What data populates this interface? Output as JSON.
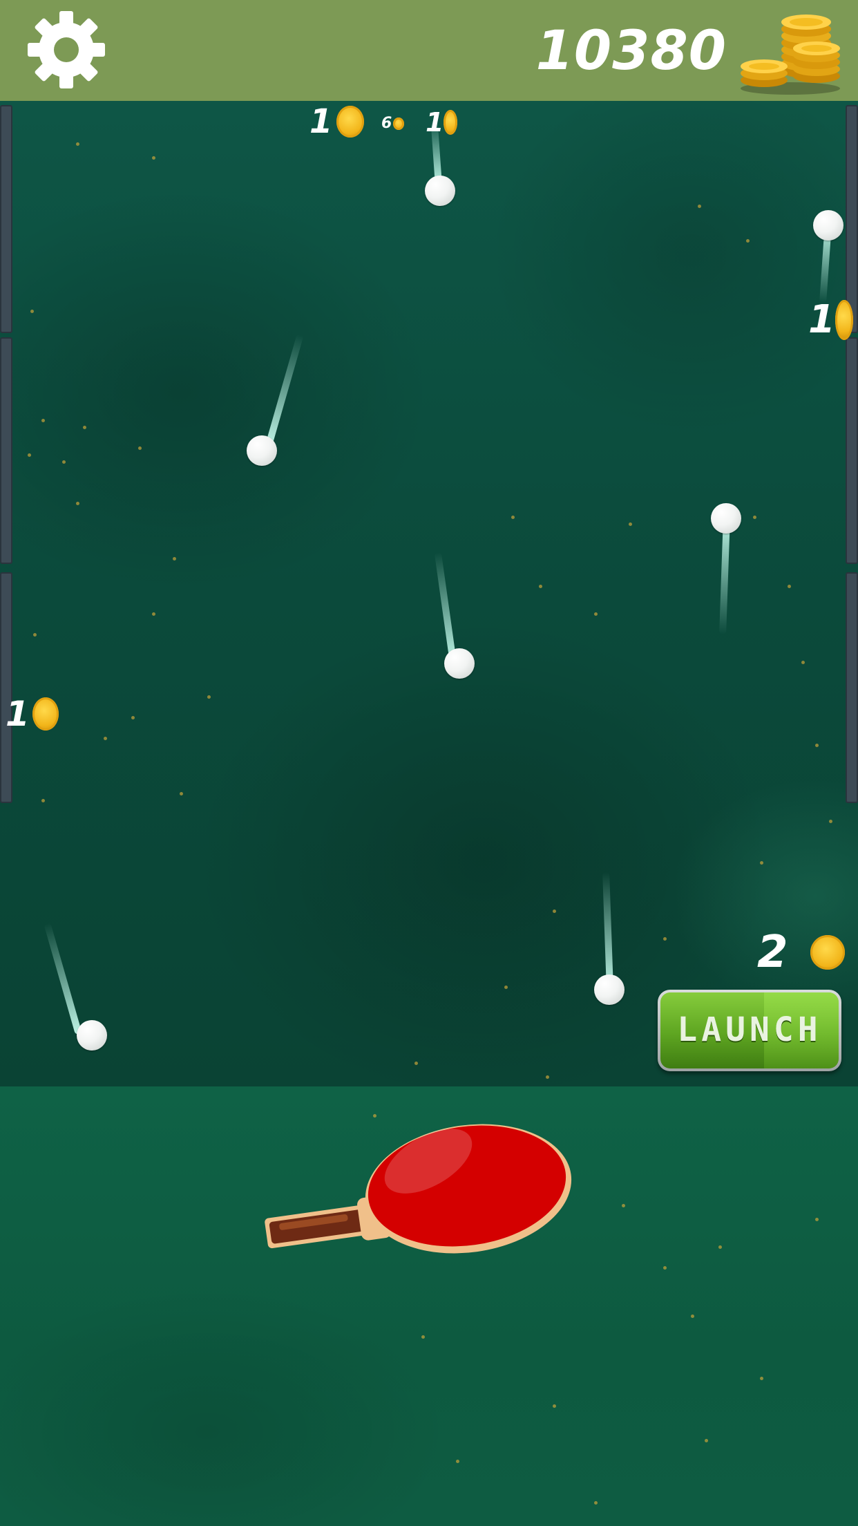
{
  "header": {
    "settings_icon": "gear-icon",
    "coin_total": "10380",
    "coin_stack_icon": "coin-stack-icon"
  },
  "coin_popups": [
    {
      "value": "1"
    },
    {
      "value": "6"
    },
    {
      "value": "1"
    },
    {
      "value": "1"
    },
    {
      "value": "1"
    }
  ],
  "launch": {
    "cost": "2",
    "label": "LAUNCH"
  },
  "colors": {
    "topbar": "#7d9a55",
    "table": "#0b4a3b",
    "paddle_rubber": "#d40000",
    "launch_green": "#5ea521",
    "coin": "#f2b51a"
  }
}
